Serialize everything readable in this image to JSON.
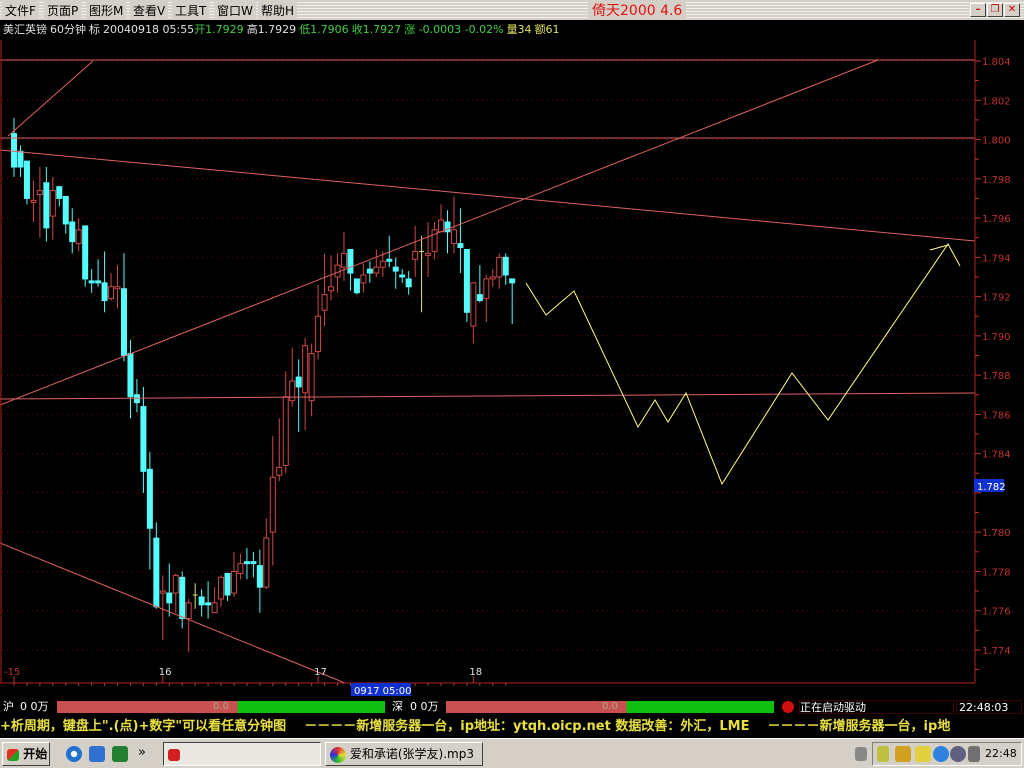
{
  "menu": [
    "文件F",
    "页面P",
    "图形M",
    "查看V",
    "工具T",
    "窗口W",
    "帮助H"
  ],
  "app_title": "倚天2000 4.6",
  "window_buttons": {
    "minimize": "–",
    "restore": "❐",
    "close": "✕"
  },
  "info": {
    "symbol": "美汇英镑",
    "period": "60分钟",
    "mark": "标",
    "datetime": "20040918 05:55",
    "open": "开1.7929",
    "high": "高1.7929",
    "low": "低1.7906",
    "close": "收1.7927",
    "change": "涨 -0.0003 -0.02%",
    "volume": "量34",
    "amount": "额61"
  },
  "colors": {
    "up": "#d04848",
    "down": "#54fcfc",
    "grid": "#7a0000",
    "axis": "#c03030",
    "projection": "#ffff80",
    "trend": "#e06060"
  },
  "chart_data": {
    "type": "candlestick",
    "ylim": [
      1.773,
      1.8045
    ],
    "y_ticks": [
      "1.804",
      "1.802",
      "1.800",
      "1.798",
      "1.796",
      "1.794",
      "1.792",
      "1.790",
      "1.788",
      "1.786",
      "1.784",
      "1.782",
      "1.780",
      "1.778",
      "1.776",
      "1.774"
    ],
    "x_ticks": [
      {
        "label": "15",
        "bar": 0
      },
      {
        "label": "16",
        "bar": 23
      },
      {
        "label": "17",
        "bar": 47
      },
      {
        "label": "18",
        "bar": 71
      }
    ],
    "cursor_time": "0917 05:00",
    "cursor_price": "1.782",
    "ohlc": [
      [
        1.8003,
        1.8011,
        1.7981,
        1.7986
      ],
      [
        1.7994,
        1.7997,
        1.7981,
        1.7986
      ],
      [
        1.7989,
        1.7989,
        1.7967,
        1.797
      ],
      [
        1.7968,
        1.7979,
        1.7958,
        1.7969
      ],
      [
        1.7972,
        1.7986,
        1.795,
        1.7974
      ],
      [
        1.7978,
        1.7986,
        1.7948,
        1.7955
      ],
      [
        1.7961,
        1.7981,
        1.7949,
        1.7974
      ],
      [
        1.7976,
        1.7976,
        1.7966,
        1.797
      ],
      [
        1.7971,
        1.7971,
        1.7952,
        1.7957
      ],
      [
        1.7958,
        1.7965,
        1.7942,
        1.7948
      ],
      [
        1.7947,
        1.796,
        1.7943,
        1.7954
      ],
      [
        1.7956,
        1.7956,
        1.7925,
        1.7929
      ],
      [
        1.7928,
        1.7934,
        1.7922,
        1.7927
      ],
      [
        1.7928,
        1.7939,
        1.7925,
        1.7927
      ],
      [
        1.7927,
        1.7943,
        1.7912,
        1.7918
      ],
      [
        1.7919,
        1.7932,
        1.7918,
        1.7925
      ],
      [
        1.7924,
        1.7936,
        1.7914,
        1.7925
      ],
      [
        1.7924,
        1.7942,
        1.7887,
        1.789
      ],
      [
        1.7891,
        1.7898,
        1.7858,
        1.7869
      ],
      [
        1.787,
        1.7878,
        1.7861,
        1.7866
      ],
      [
        1.7864,
        1.7874,
        1.782,
        1.7831
      ],
      [
        1.7832,
        1.7841,
        1.7781,
        1.7802
      ],
      [
        1.7797,
        1.7805,
        1.7761,
        1.7762
      ],
      [
        1.7769,
        1.7778,
        1.7745,
        1.777
      ],
      [
        1.7769,
        1.7784,
        1.7757,
        1.7764
      ],
      [
        1.7769,
        1.7779,
        1.7759,
        1.7778
      ],
      [
        1.7777,
        1.778,
        1.7751,
        1.7756
      ],
      [
        1.7756,
        1.7766,
        1.7739,
        1.7764
      ],
      [
        1.7768,
        1.7774,
        1.7761,
        1.7768
      ],
      [
        1.7767,
        1.7771,
        1.7757,
        1.7763
      ],
      [
        1.7764,
        1.7775,
        1.7756,
        1.7763
      ],
      [
        1.7759,
        1.7772,
        1.7759,
        1.7764
      ],
      [
        1.7766,
        1.7778,
        1.7762,
        1.7777
      ],
      [
        1.7779,
        1.7779,
        1.7765,
        1.7768
      ],
      [
        1.7769,
        1.779,
        1.7767,
        1.778
      ],
      [
        1.7779,
        1.7789,
        1.7776,
        1.7784
      ],
      [
        1.7785,
        1.7792,
        1.7776,
        1.7784
      ],
      [
        1.7785,
        1.779,
        1.7777,
        1.7784
      ],
      [
        1.7783,
        1.7791,
        1.7759,
        1.7772
      ],
      [
        1.7772,
        1.7807,
        1.7771,
        1.7797
      ],
      [
        1.78,
        1.7849,
        1.7783,
        1.7828
      ],
      [
        1.7829,
        1.7858,
        1.7826,
        1.7833
      ],
      [
        1.7834,
        1.7882,
        1.783,
        1.7869
      ],
      [
        1.7867,
        1.7894,
        1.7864,
        1.7877
      ],
      [
        1.7879,
        1.7888,
        1.7851,
        1.7874
      ],
      [
        1.7871,
        1.7899,
        1.7852,
        1.7895
      ],
      [
        1.7867,
        1.7896,
        1.7859,
        1.7891
      ],
      [
        1.7892,
        1.7926,
        1.7888,
        1.791
      ],
      [
        1.7913,
        1.7942,
        1.7905,
        1.7921
      ],
      [
        1.7923,
        1.7941,
        1.7918,
        1.7925
      ],
      [
        1.793,
        1.7942,
        1.7922,
        1.7936
      ],
      [
        1.7935,
        1.7953,
        1.7928,
        1.7942
      ],
      [
        1.7944,
        1.7944,
        1.7923,
        1.7932
      ],
      [
        1.7929,
        1.7929,
        1.7921,
        1.7922
      ],
      [
        1.7927,
        1.7937,
        1.7922,
        1.7931
      ],
      [
        1.7934,
        1.7938,
        1.7927,
        1.7932
      ],
      [
        1.7932,
        1.7944,
        1.793,
        1.7935
      ],
      [
        1.7935,
        1.7943,
        1.793,
        1.7938
      ],
      [
        1.7939,
        1.7951,
        1.7935,
        1.7938
      ],
      [
        1.7935,
        1.794,
        1.7924,
        1.7933
      ],
      [
        1.7931,
        1.7934,
        1.7927,
        1.793
      ],
      [
        1.7929,
        1.7933,
        1.7921,
        1.7925
      ],
      [
        1.7939,
        1.7956,
        1.793,
        1.7943
      ],
      [
        1.7943,
        1.7951,
        1.7912,
        1.7943
      ],
      [
        1.7941,
        1.7958,
        1.793,
        1.7942
      ],
      [
        1.7943,
        1.7958,
        1.7939,
        1.7954
      ],
      [
        1.7953,
        1.7967,
        1.7953,
        1.7959
      ],
      [
        1.7958,
        1.7964,
        1.7942,
        1.7953
      ],
      [
        1.7947,
        1.7971,
        1.7942,
        1.7954
      ],
      [
        1.7947,
        1.7965,
        1.7932,
        1.7945
      ],
      [
        1.7944,
        1.7944,
        1.7907,
        1.7912
      ],
      [
        1.7905,
        1.7927,
        1.7896,
        1.7927
      ],
      [
        1.7921,
        1.7936,
        1.7917,
        1.7918
      ],
      [
        1.7919,
        1.7931,
        1.7907,
        1.7929
      ],
      [
        1.7929,
        1.7934,
        1.7925,
        1.793
      ],
      [
        1.793,
        1.7942,
        1.7924,
        1.794
      ],
      [
        1.794,
        1.7942,
        1.7926,
        1.7931
      ],
      [
        1.7929,
        1.7929,
        1.7906,
        1.7927
      ]
    ]
  },
  "status": {
    "sh_label": "沪",
    "sh_value": "0 0万",
    "sh_bar": "0.0",
    "sz_label": "深",
    "sz_value": "0 0万",
    "sz_bar": "0.0",
    "message": "正在启动驱动",
    "time": "22:48:03"
  },
  "ticker": "+析周期，键盘上\".(点)+数字\"可以看任意分钟图    －－－－新增服务器一台，ip地址：ytqh.oicp.net 数据改善：外汇，LME    －－－－新增服务器一台，ip地",
  "taskbar": {
    "start": "开始",
    "more": "»",
    "task2": "爱和承诺(张学友).mp3",
    "clock": "22:48"
  }
}
